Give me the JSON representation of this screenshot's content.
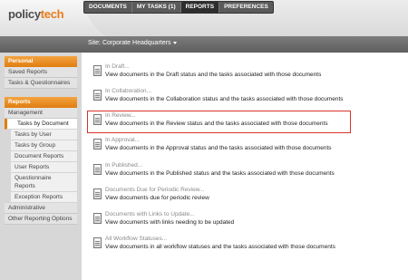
{
  "header": {
    "logo_part1": "policy",
    "logo_part2": "tech",
    "tabs": [
      {
        "label": "DOCUMENTS"
      },
      {
        "label": "MY TASKS (1)"
      },
      {
        "label": "REPORTS"
      },
      {
        "label": "PREFERENCES"
      }
    ],
    "active_tab": "REPORTS"
  },
  "site": {
    "label": "Site: Corporate Headquarters"
  },
  "sidebar": {
    "personal": {
      "title": "Personal",
      "items": [
        {
          "label": "Saved Reports"
        },
        {
          "label": "Tasks & Questionnaires"
        }
      ]
    },
    "reports": {
      "title": "Reports",
      "management": "Management",
      "sub_items": [
        {
          "label": "Tasks by Document"
        },
        {
          "label": "Tasks by User"
        },
        {
          "label": "Tasks by Group"
        },
        {
          "label": "Document Reports"
        },
        {
          "label": "User Reports"
        },
        {
          "label": "Questionnaire Reports"
        },
        {
          "label": "Exception Reports"
        }
      ],
      "selected": "Tasks by Document",
      "items_after": [
        {
          "label": "Administrative"
        },
        {
          "label": "Other Reporting Options"
        }
      ]
    }
  },
  "reports": [
    {
      "title": "In Draft...",
      "desc": "View documents in the Draft status and the tasks associated with those documents"
    },
    {
      "title": "In Collaboration...",
      "desc": "View documents in the Collaboration status and the tasks associated with those documents"
    },
    {
      "title": "In Review...",
      "desc": "View documents in the Review status and the tasks associated with those documents"
    },
    {
      "title": "In Approval...",
      "desc": "View documents in the Approval status and the tasks associated with those documents"
    },
    {
      "title": "In Published...",
      "desc": "View documents in the Published status and the tasks associated with those documents"
    },
    {
      "title": "Documents Due for Periodic Review...",
      "desc": "View documents due for periodic review"
    },
    {
      "title": "Documents with Links to Update...",
      "desc": "View documents with links needing to be updated"
    },
    {
      "title": "All Workflow Statuses...",
      "desc": "View documents in all workflow statuses and the tasks associated with those documents"
    }
  ],
  "highlighted_report": "In Review...",
  "colors": {
    "accent": "#e07d10",
    "highlight_border": "#d9332b"
  }
}
